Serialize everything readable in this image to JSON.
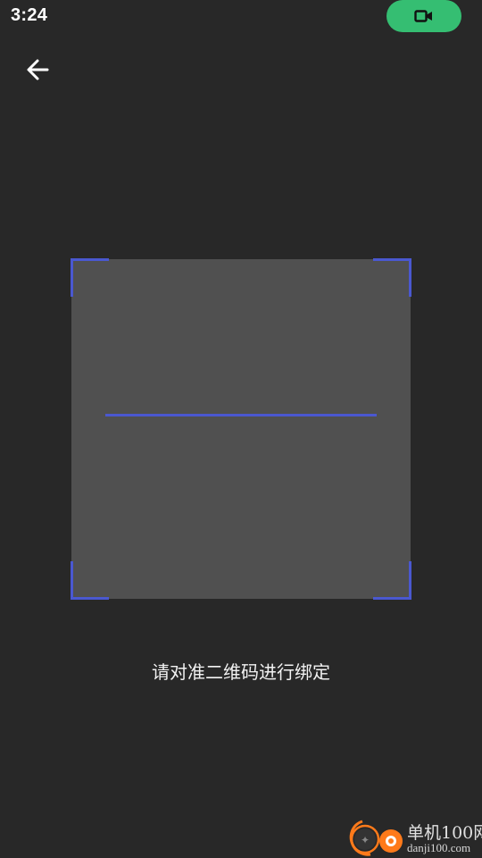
{
  "status_bar": {
    "time": "3:24",
    "record_icon": "video-camera-icon",
    "record_color": "#35be72"
  },
  "nav": {
    "back_icon": "arrow-left-icon"
  },
  "scanner": {
    "frame_color": "#505050",
    "accent_color": "#4a58d0",
    "hint": "请对准二维码进行绑定"
  },
  "watermark": {
    "logo_icon": "danji-logo-icon",
    "title": "单机100网",
    "url": "danji100.com"
  }
}
